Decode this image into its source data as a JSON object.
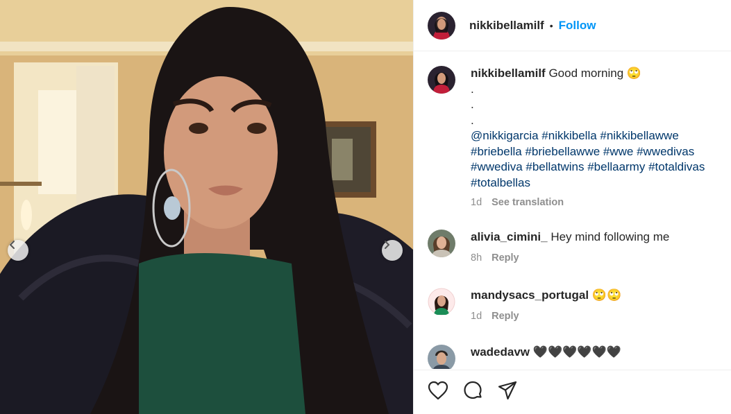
{
  "post": {
    "username": "nikkibellamilf",
    "follow_label": "Follow",
    "separator": "•"
  },
  "caption": {
    "username": "nikkibellamilf",
    "text": "Good morning 🙄",
    "dots": [
      ".",
      ".",
      "."
    ],
    "hashtags": "@nikkigarcia #nikkibella #nikkibellawwe #briebella #briebellawwe #wwe #wwedivas #wwediva #bellatwins #bellaarmy #totaldivas #totalbellas",
    "time": "1d",
    "see_translation": "See translation"
  },
  "comments": [
    {
      "username": "alivia_cimini_",
      "text": "Hey mind following me",
      "time": "8h",
      "reply": "Reply"
    },
    {
      "username": "mandysacs_portugal",
      "text": "🙄🙄",
      "time": "1d",
      "reply": "Reply"
    },
    {
      "username": "wadedavw",
      "text": "🖤🖤🖤🖤🖤🖤",
      "time": "",
      "reply": ""
    }
  ],
  "icons": {
    "like": "heart-icon",
    "comment": "comment-icon",
    "share": "paper-plane-icon",
    "prev": "chevron-left-icon",
    "next": "chevron-right-icon"
  },
  "colors": {
    "link": "#0095f6",
    "hashtag": "#00376b",
    "muted": "#8e8e8e",
    "text": "#262626"
  }
}
